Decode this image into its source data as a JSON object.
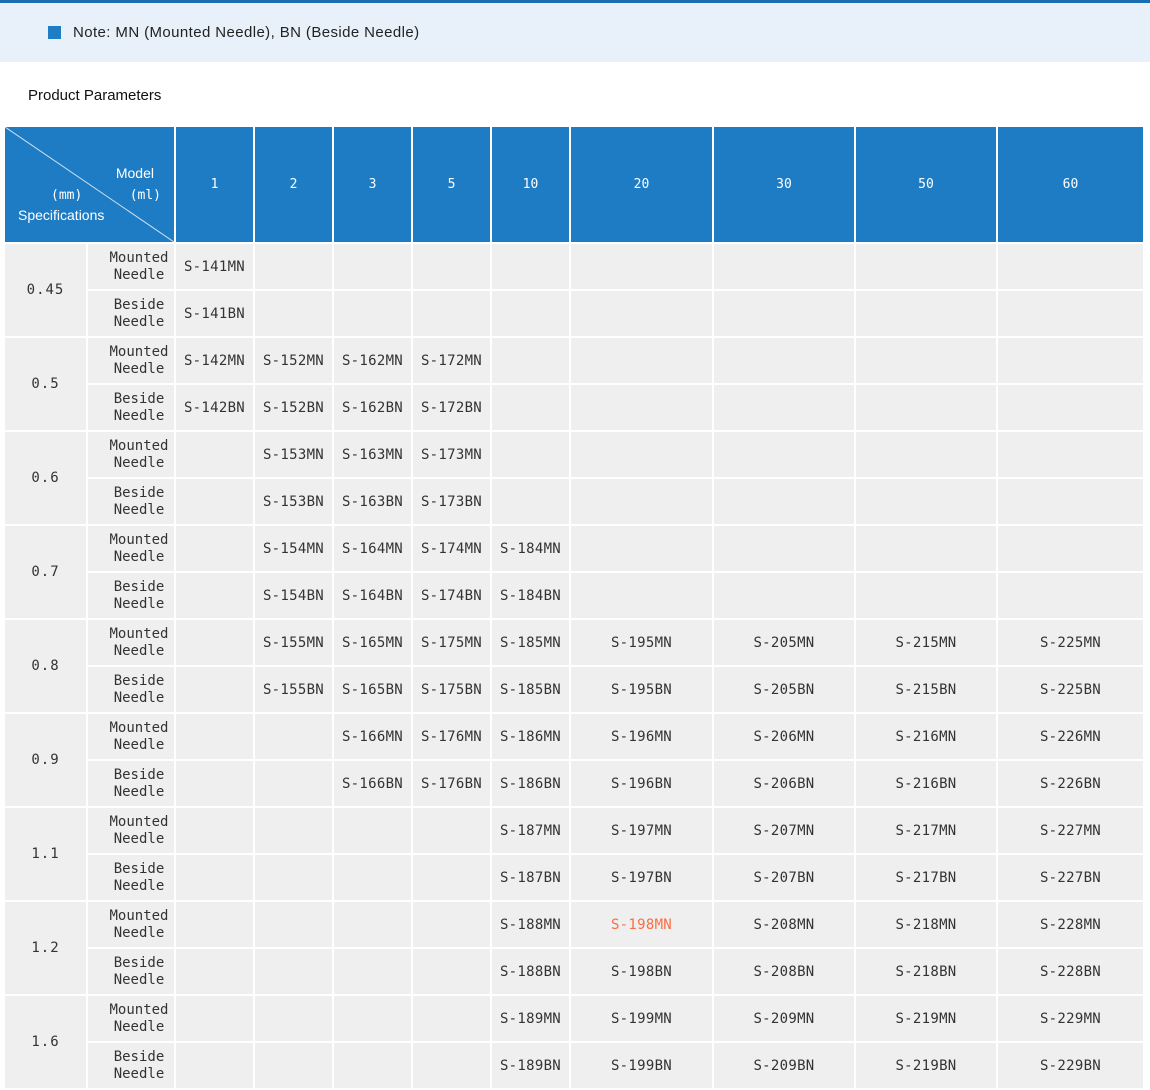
{
  "page": {
    "note": "Note: MN (Mounted Needle), BN (Beside Needle)",
    "title": "Product Parameters"
  },
  "colors": {
    "top_line": "#1b6cb0",
    "note_bar_bg": "#e8f1f9",
    "note_icon": "#1f7dc6",
    "header_bg": "#1e7cc4",
    "cell_bg": "#efefef",
    "cell_text": "#333333",
    "highlight_text": "#fb6d42"
  },
  "table": {
    "corner": {
      "model_label": "Model",
      "model_unit": "(ml)",
      "spec_unit": "(mm)",
      "spec_label": "Specifications"
    },
    "columns": [
      "1",
      "2",
      "3",
      "5",
      "10",
      "20",
      "30",
      "50",
      "60"
    ],
    "row_labels": {
      "mounted": "Mounted Needle",
      "beside": "Beside Needle"
    },
    "groups": [
      {
        "spec": "0.45",
        "mounted": [
          "S-141MN",
          "",
          "",
          "",
          "",
          "",
          "",
          "",
          ""
        ],
        "beside": [
          "S-141BN",
          "",
          "",
          "",
          "",
          "",
          "",
          "",
          ""
        ]
      },
      {
        "spec": "0.5",
        "mounted": [
          "S-142MN",
          "S-152MN",
          "S-162MN",
          "S-172MN",
          "",
          "",
          "",
          "",
          ""
        ],
        "beside": [
          "S-142BN",
          "S-152BN",
          "S-162BN",
          "S-172BN",
          "",
          "",
          "",
          "",
          ""
        ]
      },
      {
        "spec": "0.6",
        "mounted": [
          "",
          "S-153MN",
          "S-163MN",
          "S-173MN",
          "",
          "",
          "",
          "",
          ""
        ],
        "beside": [
          "",
          "S-153BN",
          "S-163BN",
          "S-173BN",
          "",
          "",
          "",
          "",
          ""
        ]
      },
      {
        "spec": "0.7",
        "mounted": [
          "",
          "S-154MN",
          "S-164MN",
          "S-174MN",
          "S-184MN",
          "",
          "",
          "",
          ""
        ],
        "beside": [
          "",
          "S-154BN",
          "S-164BN",
          "S-174BN",
          "S-184BN",
          "",
          "",
          "",
          ""
        ]
      },
      {
        "spec": "0.8",
        "mounted": [
          "",
          "S-155MN",
          "S-165MN",
          "S-175MN",
          "S-185MN",
          "S-195MN",
          "S-205MN",
          "S-215MN",
          "S-225MN"
        ],
        "beside": [
          "",
          "S-155BN",
          "S-165BN",
          "S-175BN",
          "S-185BN",
          "S-195BN",
          "S-205BN",
          "S-215BN",
          "S-225BN"
        ]
      },
      {
        "spec": "0.9",
        "mounted": [
          "",
          "",
          "S-166MN",
          "S-176MN",
          "S-186MN",
          "S-196MN",
          "S-206MN",
          "S-216MN",
          "S-226MN"
        ],
        "beside": [
          "",
          "",
          "S-166BN",
          "S-176BN",
          "S-186BN",
          "S-196BN",
          "S-206BN",
          "S-216BN",
          "S-226BN"
        ]
      },
      {
        "spec": "1.1",
        "mounted": [
          "",
          "",
          "",
          "",
          "S-187MN",
          "S-197MN",
          "S-207MN",
          "S-217MN",
          "S-227MN"
        ],
        "beside": [
          "",
          "",
          "",
          "",
          "S-187BN",
          "S-197BN",
          "S-207BN",
          "S-217BN",
          "S-227BN"
        ]
      },
      {
        "spec": "1.2",
        "mounted": [
          "",
          "",
          "",
          "",
          "S-188MN",
          "S-198MN",
          "S-208MN",
          "S-218MN",
          "S-228MN"
        ],
        "beside": [
          "",
          "",
          "",
          "",
          "S-188BN",
          "S-198BN",
          "S-208BN",
          "S-218BN",
          "S-228BN"
        ]
      },
      {
        "spec": "1.6",
        "mounted": [
          "",
          "",
          "",
          "",
          "S-189MN",
          "S-199MN",
          "S-209MN",
          "S-219MN",
          "S-229MN"
        ],
        "beside": [
          "",
          "",
          "",
          "",
          "S-189BN",
          "S-199BN",
          "S-209BN",
          "S-219BN",
          "S-229BN"
        ]
      }
    ],
    "highlight": {
      "group_spec": "1.2",
      "row": "mounted",
      "column": "20",
      "value": "S-198MN"
    }
  }
}
